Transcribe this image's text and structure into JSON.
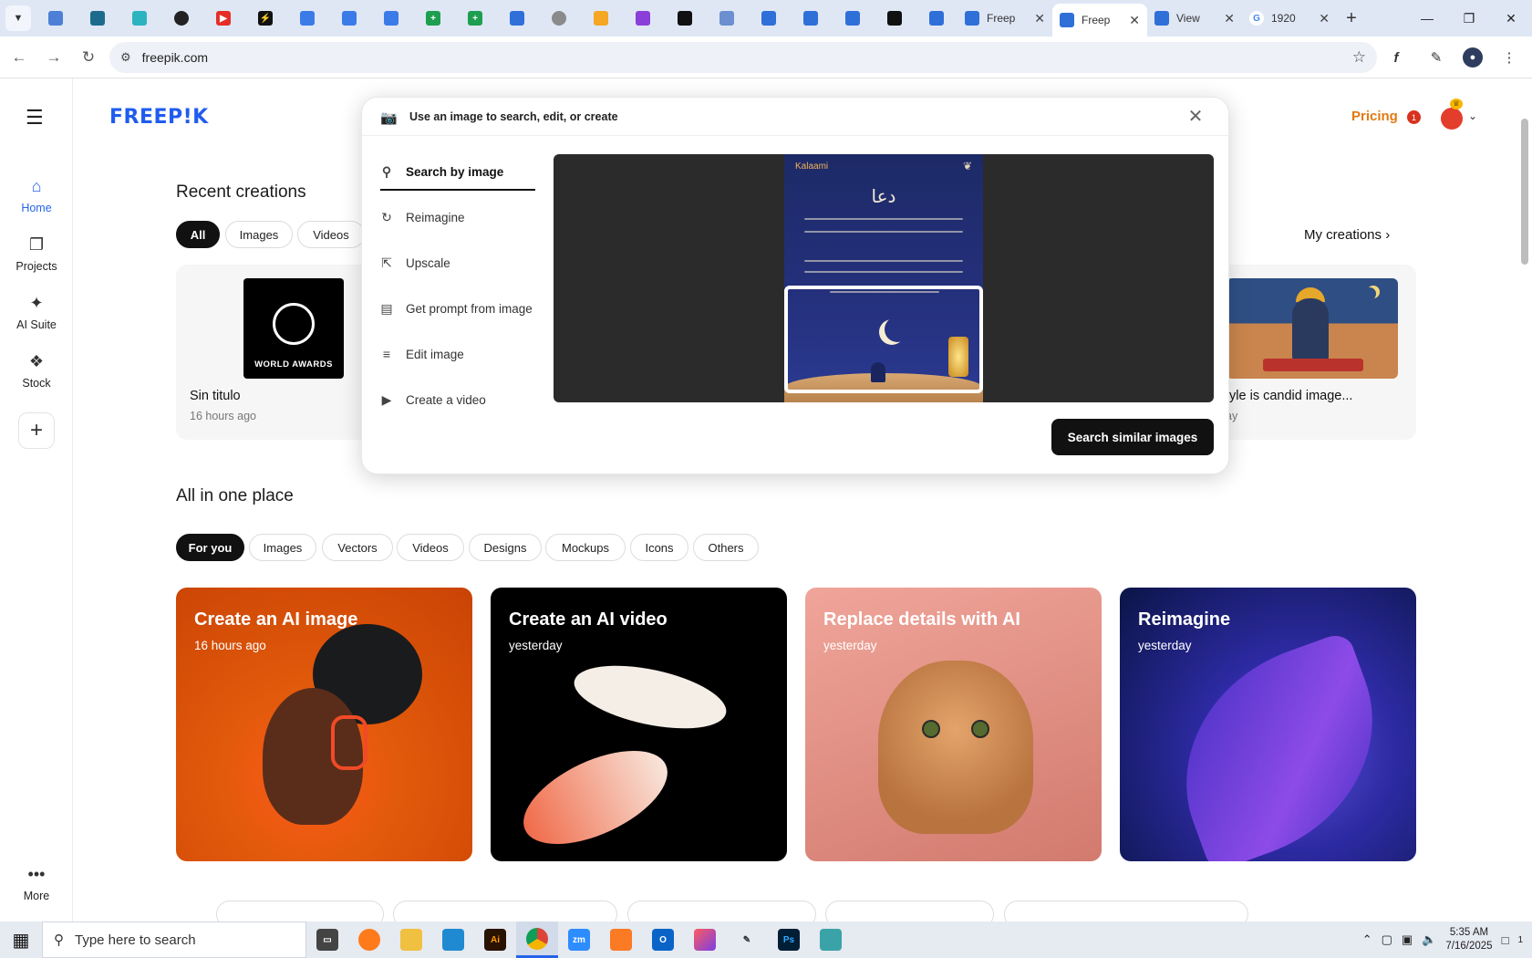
{
  "browser": {
    "pinned_tab_count": 22,
    "tabs": [
      {
        "title": "Freep",
        "active": false
      },
      {
        "title": "Freep",
        "active": true
      },
      {
        "title": "View",
        "active": false
      },
      {
        "title": "1920",
        "active": false
      }
    ],
    "url": "freepik.com"
  },
  "sidebar": {
    "items": [
      {
        "label": "Home",
        "icon": "home-icon"
      },
      {
        "label": "Projects",
        "icon": "projects-icon"
      },
      {
        "label": "AI Suite",
        "icon": "sparkle-icon"
      },
      {
        "label": "Stock",
        "icon": "stock-icon"
      }
    ],
    "more_label": "More"
  },
  "header": {
    "logo": "FREEP!K",
    "pricing": "Pricing",
    "notification_count": "1"
  },
  "recent": {
    "title": "Recent creations",
    "filters": [
      "All",
      "Images",
      "Videos"
    ],
    "my_creations": "My creations",
    "items": [
      {
        "title": "Sin titulo",
        "time": "16 hours ago",
        "badge_text": "WORLD AWARDS"
      },
      {
        "title": "tyle is candid image...",
        "time": "ay"
      }
    ]
  },
  "all_in_one": {
    "title": "All in one place",
    "filters": [
      "For you",
      "Images",
      "Vectors",
      "Videos",
      "Designs",
      "Mockups",
      "Icons",
      "Others"
    ],
    "cards": [
      {
        "title": "Create an AI image",
        "time": "16 hours ago"
      },
      {
        "title": "Create an AI video",
        "time": "yesterday"
      },
      {
        "title": "Replace details with AI",
        "time": "yesterday"
      },
      {
        "title": "Reimagine",
        "time": "yesterday"
      }
    ]
  },
  "popover": {
    "title": "Use an image to search, edit, or create",
    "menu": [
      {
        "label": "Search by image",
        "icon": "search-icon"
      },
      {
        "label": "Reimagine",
        "icon": "refresh-icon"
      },
      {
        "label": "Upscale",
        "icon": "upscale-icon"
      },
      {
        "label": "Get prompt from image",
        "icon": "prompt-icon"
      },
      {
        "label": "Edit image",
        "icon": "sliders-icon"
      },
      {
        "label": "Create a video",
        "icon": "video-icon"
      }
    ],
    "preview": {
      "brand": "Kalaami",
      "heading": "دعا"
    },
    "action_button": "Search similar images"
  },
  "taskbar": {
    "search_placeholder": "Type here to search",
    "time": "5:35 AM",
    "date": "7/16/2025",
    "notification_count": "1"
  },
  "colors": {
    "brand_blue": "#1f5cf0",
    "pricing_orange": "#e07a12",
    "accent_dark": "#111111"
  }
}
